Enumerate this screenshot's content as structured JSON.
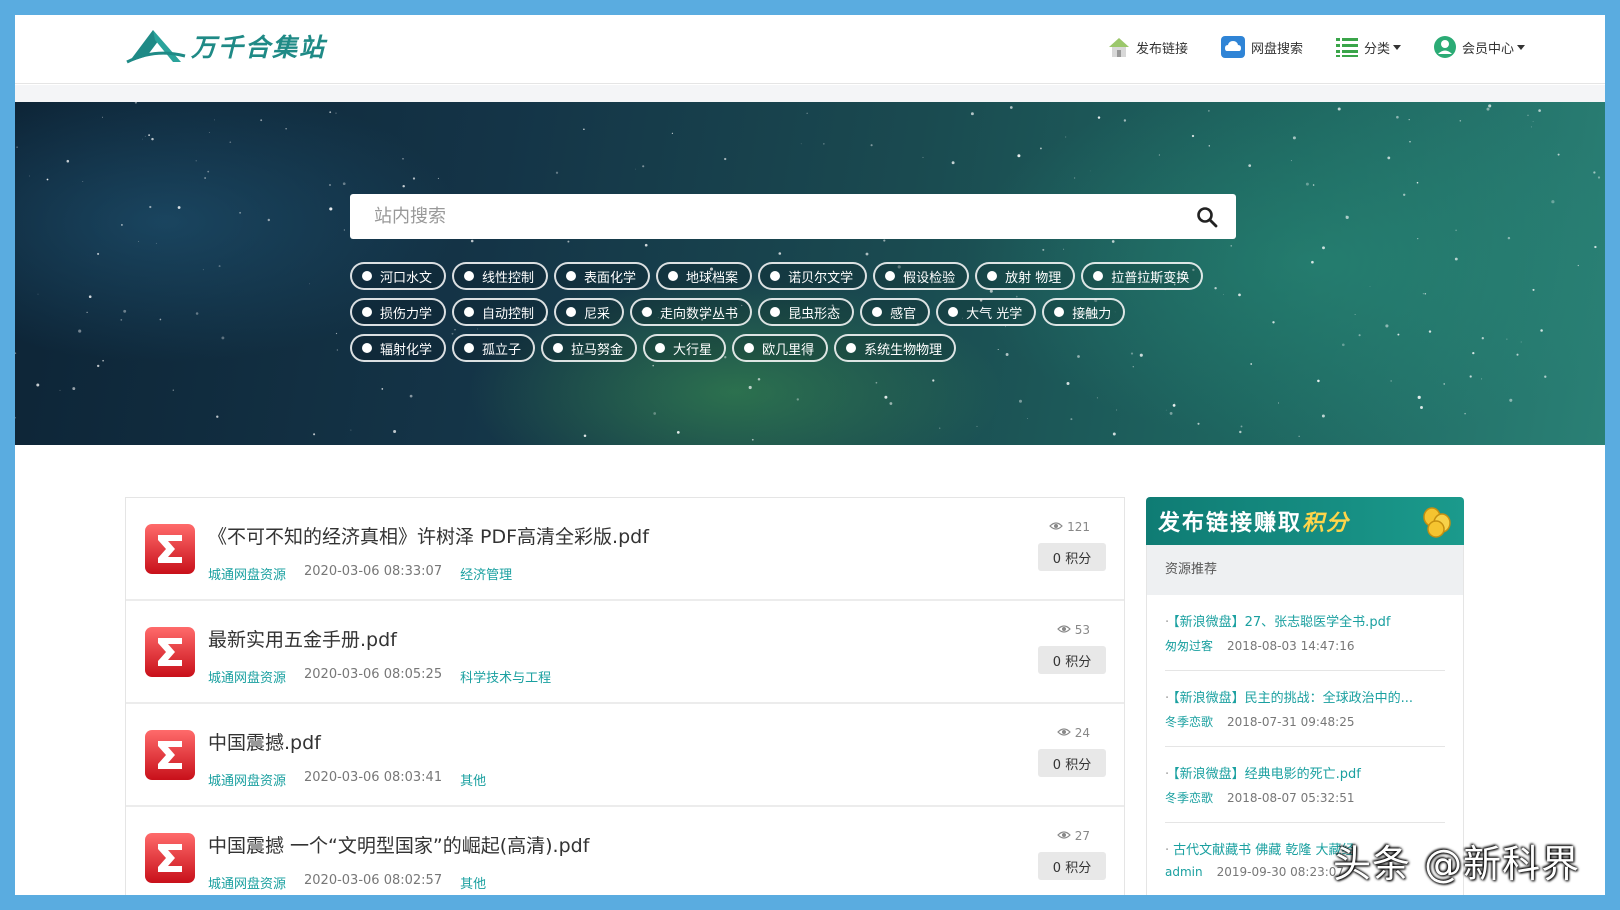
{
  "site": {
    "name": "万千合集站"
  },
  "nav": {
    "publish": "发布链接",
    "disk_search": "网盘搜索",
    "category": "分类",
    "member": "会员中心"
  },
  "search": {
    "placeholder": "站内搜索"
  },
  "tag_rows": [
    [
      "河口水文",
      "线性控制",
      "表面化学",
      "地球档案",
      "诺贝尔文学",
      "假设检验",
      "放射 物理",
      "拉普拉斯变换"
    ],
    [
      "损伤力学",
      "自动控制",
      "尼采",
      "走向数学丛书",
      "昆虫形态",
      "感官",
      "大气 光学",
      "接触力"
    ],
    [
      "辐射化学",
      "孤立子",
      "拉马努金",
      "大行星",
      "欧几里得",
      "系统生物物理"
    ]
  ],
  "items": [
    {
      "title": "《不可不知的经济真相》许树泽 PDF高清全彩版.pdf",
      "source": "城通网盘资源",
      "date": "2020-03-06 08:33:07",
      "category": "经济管理",
      "views": "121",
      "points": "0 积分"
    },
    {
      "title": "最新实用五金手册.pdf",
      "source": "城通网盘资源",
      "date": "2020-03-06 08:05:25",
      "category": "科学技术与工程",
      "views": "53",
      "points": "0 积分"
    },
    {
      "title": "中国震撼.pdf",
      "source": "城通网盘资源",
      "date": "2020-03-06 08:03:41",
      "category": "其他",
      "views": "24",
      "points": "0 积分"
    },
    {
      "title": "中国震撼 一个“文明型国家”的崛起(高清).pdf",
      "source": "城通网盘资源",
      "date": "2020-03-06 08:02:57",
      "category": "其他",
      "views": "27",
      "points": "0 积分"
    }
  ],
  "promo": {
    "text": "发布链接赚取",
    "highlight": "积分"
  },
  "sidebar": {
    "heading": "资源推荐",
    "items": [
      {
        "title": "【新浪微盘】27、张志聪医学全书.pdf",
        "user": "匆匆过客",
        "date": "2018-08-03 14:47:16"
      },
      {
        "title": "【新浪微盘】民主的挑战：全球政治中的...",
        "user": "冬季恋歌",
        "date": "2018-07-31 09:48:25"
      },
      {
        "title": "【新浪微盘】经典电影的死亡.pdf",
        "user": "冬季恋歌",
        "date": "2018-08-07 05:32:51"
      },
      {
        "title": "古代文献藏书 佛藏 乾隆 大藏经",
        "user": "admin",
        "date": "2019-09-30 08:23:07"
      }
    ]
  },
  "watermark": "头条 @新科界",
  "colors": {
    "accent": "#1aa0a0",
    "brand": "#1f8a86",
    "frame": "#5aace0"
  }
}
